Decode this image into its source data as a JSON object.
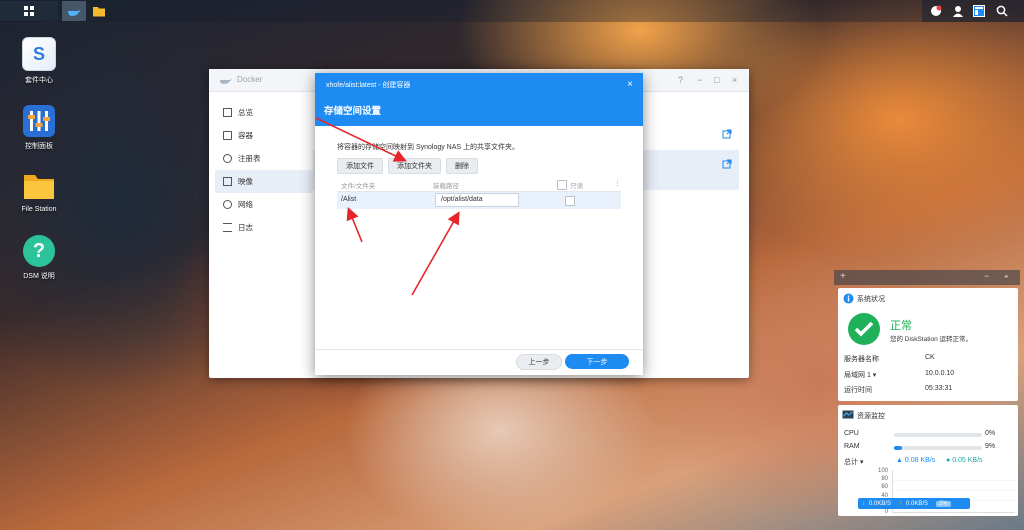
{
  "desktop": {
    "icons": [
      {
        "label": "套件中心",
        "icon": "package-center-icon"
      },
      {
        "label": "控制面板",
        "icon": "control-panel-icon"
      },
      {
        "label": "File Station",
        "icon": "folder-icon"
      },
      {
        "label": "DSM 说明",
        "icon": "help-icon"
      }
    ]
  },
  "docker": {
    "title": "Docker",
    "nav": [
      {
        "label": "总览",
        "icon": "overview-icon"
      },
      {
        "label": "容器",
        "icon": "container-icon"
      },
      {
        "label": "注册表",
        "icon": "registry-icon"
      },
      {
        "label": "映像",
        "icon": "image-icon"
      },
      {
        "label": "网络",
        "icon": "network-icon"
      },
      {
        "label": "日志",
        "icon": "log-icon"
      }
    ],
    "active_nav": "映像"
  },
  "dialog": {
    "title": "xhofe/alist:latest - 创建容器",
    "subtitle": "存储空间设置",
    "description": "将容器的存储空间映射到 Synology NAS 上的共享文件夹。",
    "buttons": {
      "add_file": "添加文件",
      "add_folder": "添加文件夹",
      "delete": "删除"
    },
    "table": {
      "columns": {
        "file_folder": "文件/文件夹",
        "mount_path": "装载路径",
        "readonly": "只读"
      },
      "rows": [
        {
          "file_folder": "/Alist",
          "mount_path": "/opt/alist/data",
          "readonly": false
        }
      ]
    },
    "footer": {
      "prev": "上一步",
      "next": "下一步"
    }
  },
  "system_status": {
    "title": "系统状况",
    "status": "正常",
    "status_desc": "您的 DiskStation 运转正常。",
    "rows": [
      {
        "label": "服务器名称",
        "value": "CK"
      },
      {
        "label": "局域网 1 ▾",
        "value": "10.0.0.10"
      },
      {
        "label": "运行时间",
        "value": "05:33:31"
      }
    ]
  },
  "resource_monitor": {
    "title": "资源监控",
    "cpu": {
      "label": "CPU",
      "value": "0%",
      "fraction": 0.0
    },
    "ram": {
      "label": "RAM",
      "value": "9%",
      "fraction": 0.09
    },
    "total": {
      "label": "总计 ▾",
      "up": "0.08 KB/s",
      "down": "0.05 KB/s"
    },
    "axis": [
      "100",
      "80",
      "60",
      "40",
      "20",
      "0"
    ],
    "legend": {
      "down": "0.0KB/S",
      "up": "0.0KB/S",
      "percent": "2%"
    }
  },
  "colors": {
    "accent": "#1d8bf1",
    "ok": "#1fb15a"
  }
}
